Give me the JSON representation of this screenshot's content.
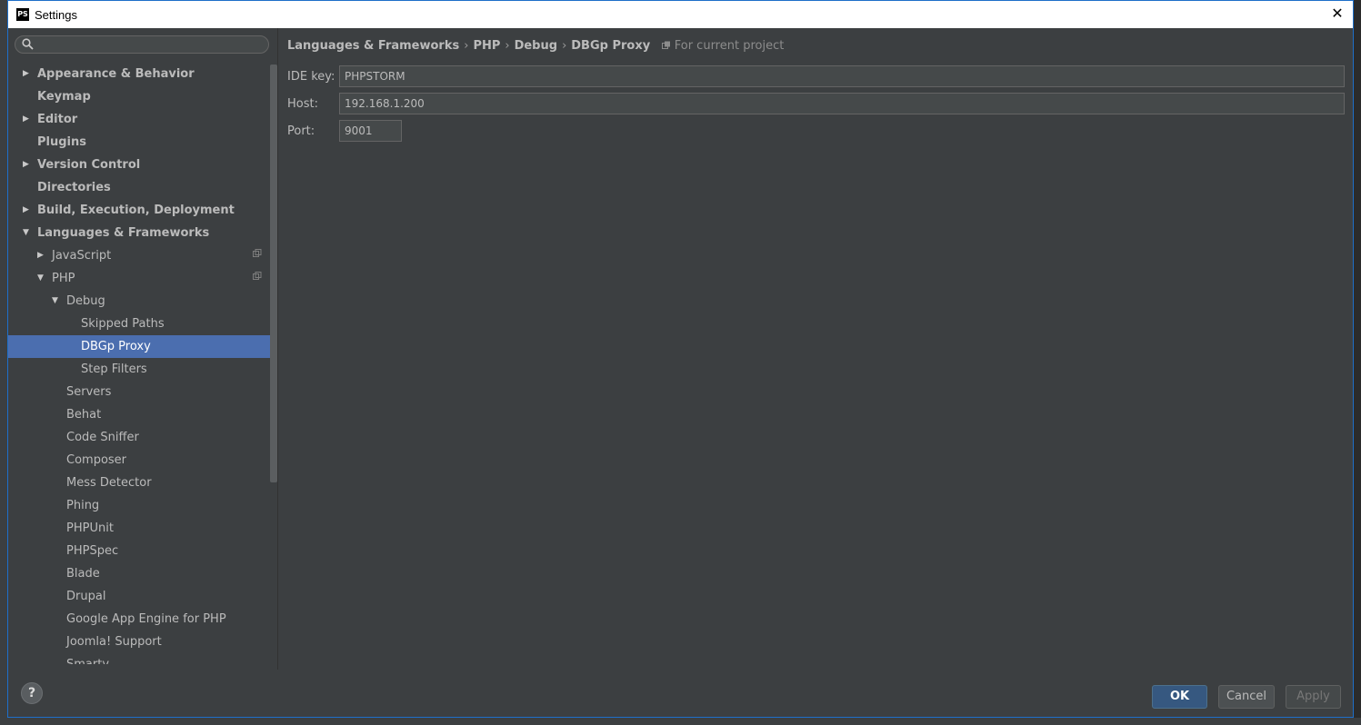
{
  "window": {
    "title": "Settings",
    "app_icon_text": "PS"
  },
  "search": {
    "placeholder": "",
    "value": ""
  },
  "tree": [
    {
      "label": "Appearance & Behavior",
      "bold": true,
      "arrow": "collapsed",
      "level": 0
    },
    {
      "label": "Keymap",
      "bold": true,
      "arrow": "none",
      "level": 0
    },
    {
      "label": "Editor",
      "bold": true,
      "arrow": "collapsed",
      "level": 0
    },
    {
      "label": "Plugins",
      "bold": true,
      "arrow": "none",
      "level": 0
    },
    {
      "label": "Version Control",
      "bold": true,
      "arrow": "collapsed",
      "level": 0
    },
    {
      "label": "Directories",
      "bold": true,
      "arrow": "none",
      "level": 0
    },
    {
      "label": "Build, Execution, Deployment",
      "bold": true,
      "arrow": "collapsed",
      "level": 0
    },
    {
      "label": "Languages & Frameworks",
      "bold": true,
      "arrow": "expanded",
      "level": 0
    },
    {
      "label": "JavaScript",
      "bold": false,
      "arrow": "collapsed",
      "level": 1,
      "project_icon": true
    },
    {
      "label": "PHP",
      "bold": false,
      "arrow": "expanded",
      "level": 1,
      "project_icon": true
    },
    {
      "label": "Debug",
      "bold": false,
      "arrow": "expanded",
      "level": 2
    },
    {
      "label": "Skipped Paths",
      "bold": false,
      "arrow": "none",
      "level": 3
    },
    {
      "label": "DBGp Proxy",
      "bold": false,
      "arrow": "none",
      "level": 3,
      "selected": true
    },
    {
      "label": "Step Filters",
      "bold": false,
      "arrow": "none",
      "level": 3
    },
    {
      "label": "Servers",
      "bold": false,
      "arrow": "none",
      "level": 2
    },
    {
      "label": "Behat",
      "bold": false,
      "arrow": "none",
      "level": 2
    },
    {
      "label": "Code Sniffer",
      "bold": false,
      "arrow": "none",
      "level": 2
    },
    {
      "label": "Composer",
      "bold": false,
      "arrow": "none",
      "level": 2
    },
    {
      "label": "Mess Detector",
      "bold": false,
      "arrow": "none",
      "level": 2
    },
    {
      "label": "Phing",
      "bold": false,
      "arrow": "none",
      "level": 2
    },
    {
      "label": "PHPUnit",
      "bold": false,
      "arrow": "none",
      "level": 2
    },
    {
      "label": "PHPSpec",
      "bold": false,
      "arrow": "none",
      "level": 2
    },
    {
      "label": "Blade",
      "bold": false,
      "arrow": "none",
      "level": 2
    },
    {
      "label": "Drupal",
      "bold": false,
      "arrow": "none",
      "level": 2
    },
    {
      "label": "Google App Engine for PHP",
      "bold": false,
      "arrow": "none",
      "level": 2
    },
    {
      "label": "Joomla! Support",
      "bold": false,
      "arrow": "none",
      "level": 2
    },
    {
      "label": "Smarty",
      "bold": false,
      "arrow": "none",
      "level": 2
    }
  ],
  "breadcrumb": {
    "items": [
      "Languages & Frameworks",
      "PHP",
      "Debug",
      "DBGp Proxy"
    ],
    "separator": "›",
    "scope_hint": "For current project"
  },
  "form": {
    "ide_key_label": "IDE key:",
    "ide_key_value": "PHPSTORM",
    "host_label": "Host:",
    "host_value": "192.168.1.200",
    "port_label": "Port:",
    "port_value": "9001"
  },
  "footer": {
    "help_label": "?",
    "ok_label": "OK",
    "cancel_label": "Cancel",
    "apply_label": "Apply"
  },
  "colors": {
    "dialog_bg": "#3c3f41",
    "selection": "#4b6eaf",
    "ok_button": "#365880",
    "window_border": "#1e6fc9"
  }
}
